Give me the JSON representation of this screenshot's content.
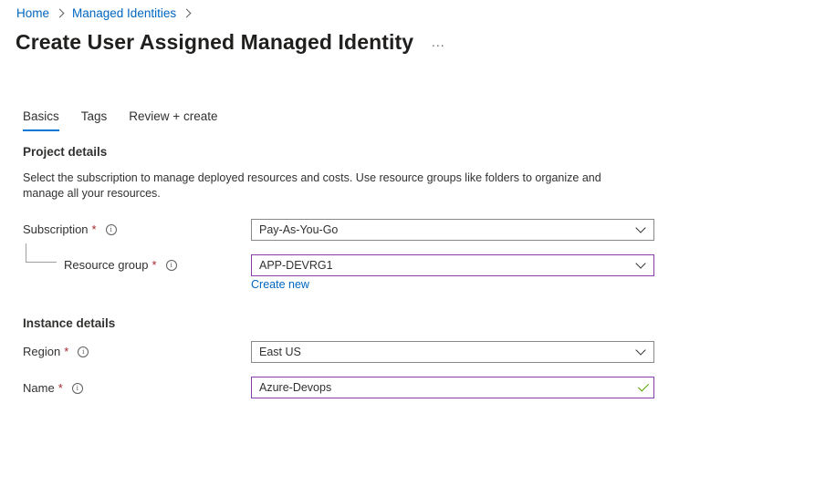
{
  "breadcrumb": {
    "items": [
      {
        "label": "Home"
      },
      {
        "label": "Managed Identities"
      }
    ]
  },
  "header": {
    "title": "Create User Assigned Managed Identity",
    "more_icon": "ellipsis-icon",
    "more_label": "..."
  },
  "tabs": [
    {
      "label": "Basics",
      "active": true
    },
    {
      "label": "Tags",
      "active": false
    },
    {
      "label": "Review + create",
      "active": false
    }
  ],
  "project_details": {
    "title": "Project details",
    "description": "Select the subscription to manage deployed resources and costs. Use resource groups like folders to organize and manage all your resources.",
    "subscription": {
      "label": "Subscription",
      "required_mark": "*",
      "info_icon": "info-icon",
      "value": "Pay-As-You-Go"
    },
    "resource_group": {
      "label": "Resource group",
      "required_mark": "*",
      "info_icon": "info-icon",
      "value": "APP-DEVRG1",
      "create_new_label": "Create new"
    }
  },
  "instance_details": {
    "title": "Instance details",
    "region": {
      "label": "Region",
      "required_mark": "*",
      "info_icon": "info-icon",
      "value": "East US"
    },
    "name": {
      "label": "Name",
      "required_mark": "*",
      "info_icon": "info-icon",
      "value": "Azure-Devops",
      "valid_icon": "checkmark-icon"
    }
  },
  "colors": {
    "link": "#0066c0",
    "accent_tab": "#0078d4",
    "required": "#a4262c",
    "focused_border": "#8a3ca8",
    "valid_check": "#57a300"
  }
}
